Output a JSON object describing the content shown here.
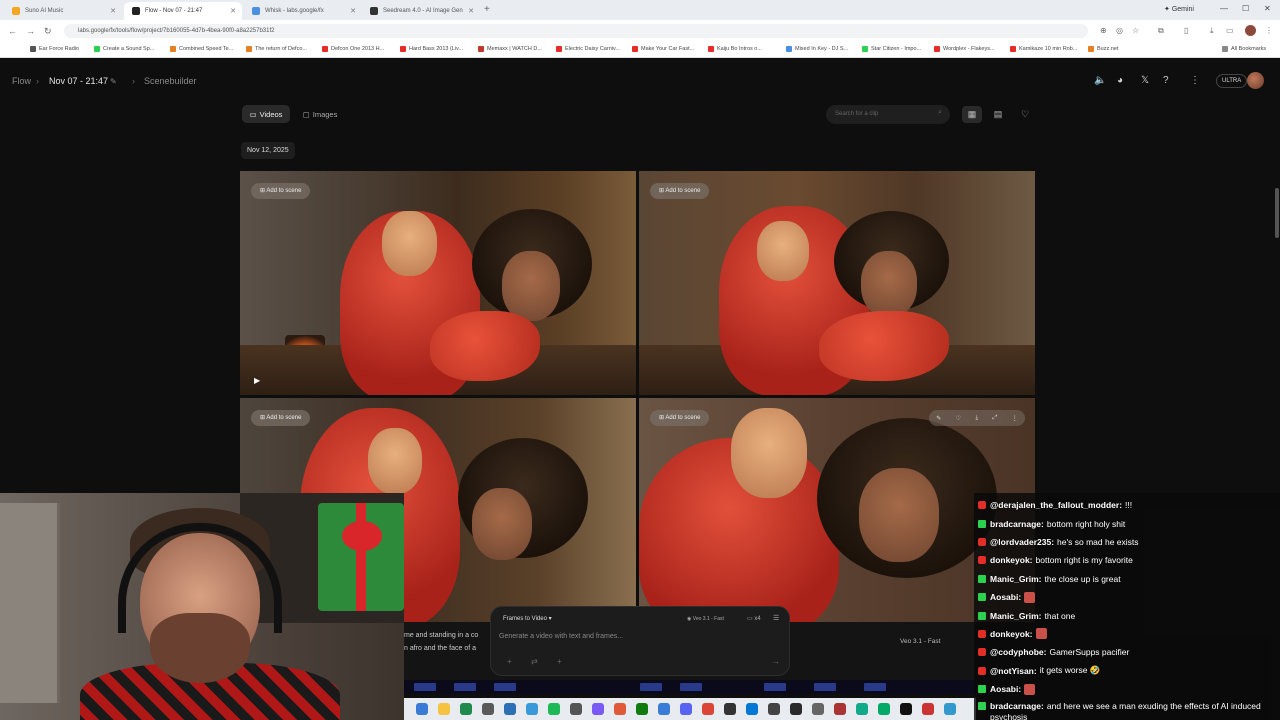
{
  "browser": {
    "tabs": [
      {
        "title": "Suno AI Music",
        "color": "#f5a623",
        "active": false
      },
      {
        "title": "Flow - Nov 07 - 21:47",
        "color": "#222222",
        "active": true
      },
      {
        "title": "Whisk - labs.google/fx",
        "color": "#4a90e2",
        "active": false
      },
      {
        "title": "Seedream 4.0 - AI Image Gen",
        "color": "#333333",
        "active": false
      }
    ],
    "new_tab": "+",
    "gemini": "Gemini",
    "url": "labs.google/fx/tools/flow/project/7b160055-4d7b-4bea-90f0-a8a2257b31f2",
    "bookmarks": [
      {
        "label": "Ear Force Radio",
        "color": "#555555"
      },
      {
        "label": "Create a Sound Sp...",
        "color": "#2bd14f"
      },
      {
        "label": "Combined Speed Te...",
        "color": "#e67e22"
      },
      {
        "label": "The return of Defco...",
        "color": "#e67e22"
      },
      {
        "label": "Defcon One 2013 H...",
        "color": "#e52d27"
      },
      {
        "label": "Hard Bass 2013 (Liv...",
        "color": "#e52d27"
      },
      {
        "label": "Memaxx | WATCH D...",
        "color": "#c0392b"
      },
      {
        "label": "Electric Daisy Carniv...",
        "color": "#e52d27"
      },
      {
        "label": "Make Your Car Fast...",
        "color": "#e52d27"
      },
      {
        "label": "Kaiju Bo Intros o...",
        "color": "#e52d27"
      },
      {
        "label": "Mixed In Key - DJ S...",
        "color": "#4a90e2"
      },
      {
        "label": "Star Citizen - Impo...",
        "color": "#2bd14f"
      },
      {
        "label": "Wordplex - Flakeys...",
        "color": "#e52d27"
      },
      {
        "label": "Kamikaze 10 min Rob...",
        "color": "#e52d27"
      },
      {
        "label": "Buzz.net",
        "color": "#e67e22"
      }
    ],
    "all_bookmarks": "All Bookmarks"
  },
  "header": {
    "crumb_root": "Flow",
    "project": "Nov 07 - 21:47",
    "section": "Scenebuilder",
    "plan_badge": "ULTRA"
  },
  "toolbar": {
    "videos_label": "Videos",
    "images_label": "Images",
    "search_placeholder": "Search for a clip"
  },
  "date_group": "Nov 12, 2025",
  "clips": [
    {
      "add_label": "Add to scene"
    },
    {
      "add_label": "Add to scene"
    },
    {
      "add_label": "Add to scene"
    },
    {
      "add_label": "Add to scene"
    }
  ],
  "prompt": {
    "mode": "Frames to Video",
    "model": "Veo 3.1 - Fast",
    "count": "x4",
    "placeholder": "Generate a video with text and frames..."
  },
  "scene": {
    "text_line1": "me and standing in a co",
    "text_line2": "n afro and the face of a",
    "model": "Veo 3.1 - Fast"
  },
  "chat": [
    {
      "user": "@derajalen_the_fallout_modder:",
      "text": "!!!",
      "badge": "yt"
    },
    {
      "user": "bradcarnage:",
      "text": "bottom right holy shit",
      "badge": "tw"
    },
    {
      "user": "@lordvader235:",
      "text": "he's so mad he exists",
      "badge": "yt"
    },
    {
      "user": "donkeyok:",
      "text": "bottom right is my favorite",
      "badge": "yt"
    },
    {
      "user": "Manic_Grim:",
      "text": "the close up is great",
      "badge": "tw"
    },
    {
      "user": "Aosabi:",
      "text": "",
      "badge": "tw",
      "emote": true
    },
    {
      "user": "Manic_Grim:",
      "text": "that one",
      "badge": "tw"
    },
    {
      "user": "donkeyok:",
      "text": "",
      "badge": "yt",
      "emote": true
    },
    {
      "user": "@codyphobe:",
      "text": "GamerSupps pacifier",
      "badge": "yt"
    },
    {
      "user": "@notYisan:",
      "text": "it gets worse 🤣",
      "badge": "yt"
    },
    {
      "user": "Aosabi:",
      "text": "",
      "badge": "tw",
      "emote": true
    },
    {
      "user": "bradcarnage:",
      "text": "and here we see a man exuding the effects of AI induced psychosis",
      "badge": "tw"
    }
  ]
}
